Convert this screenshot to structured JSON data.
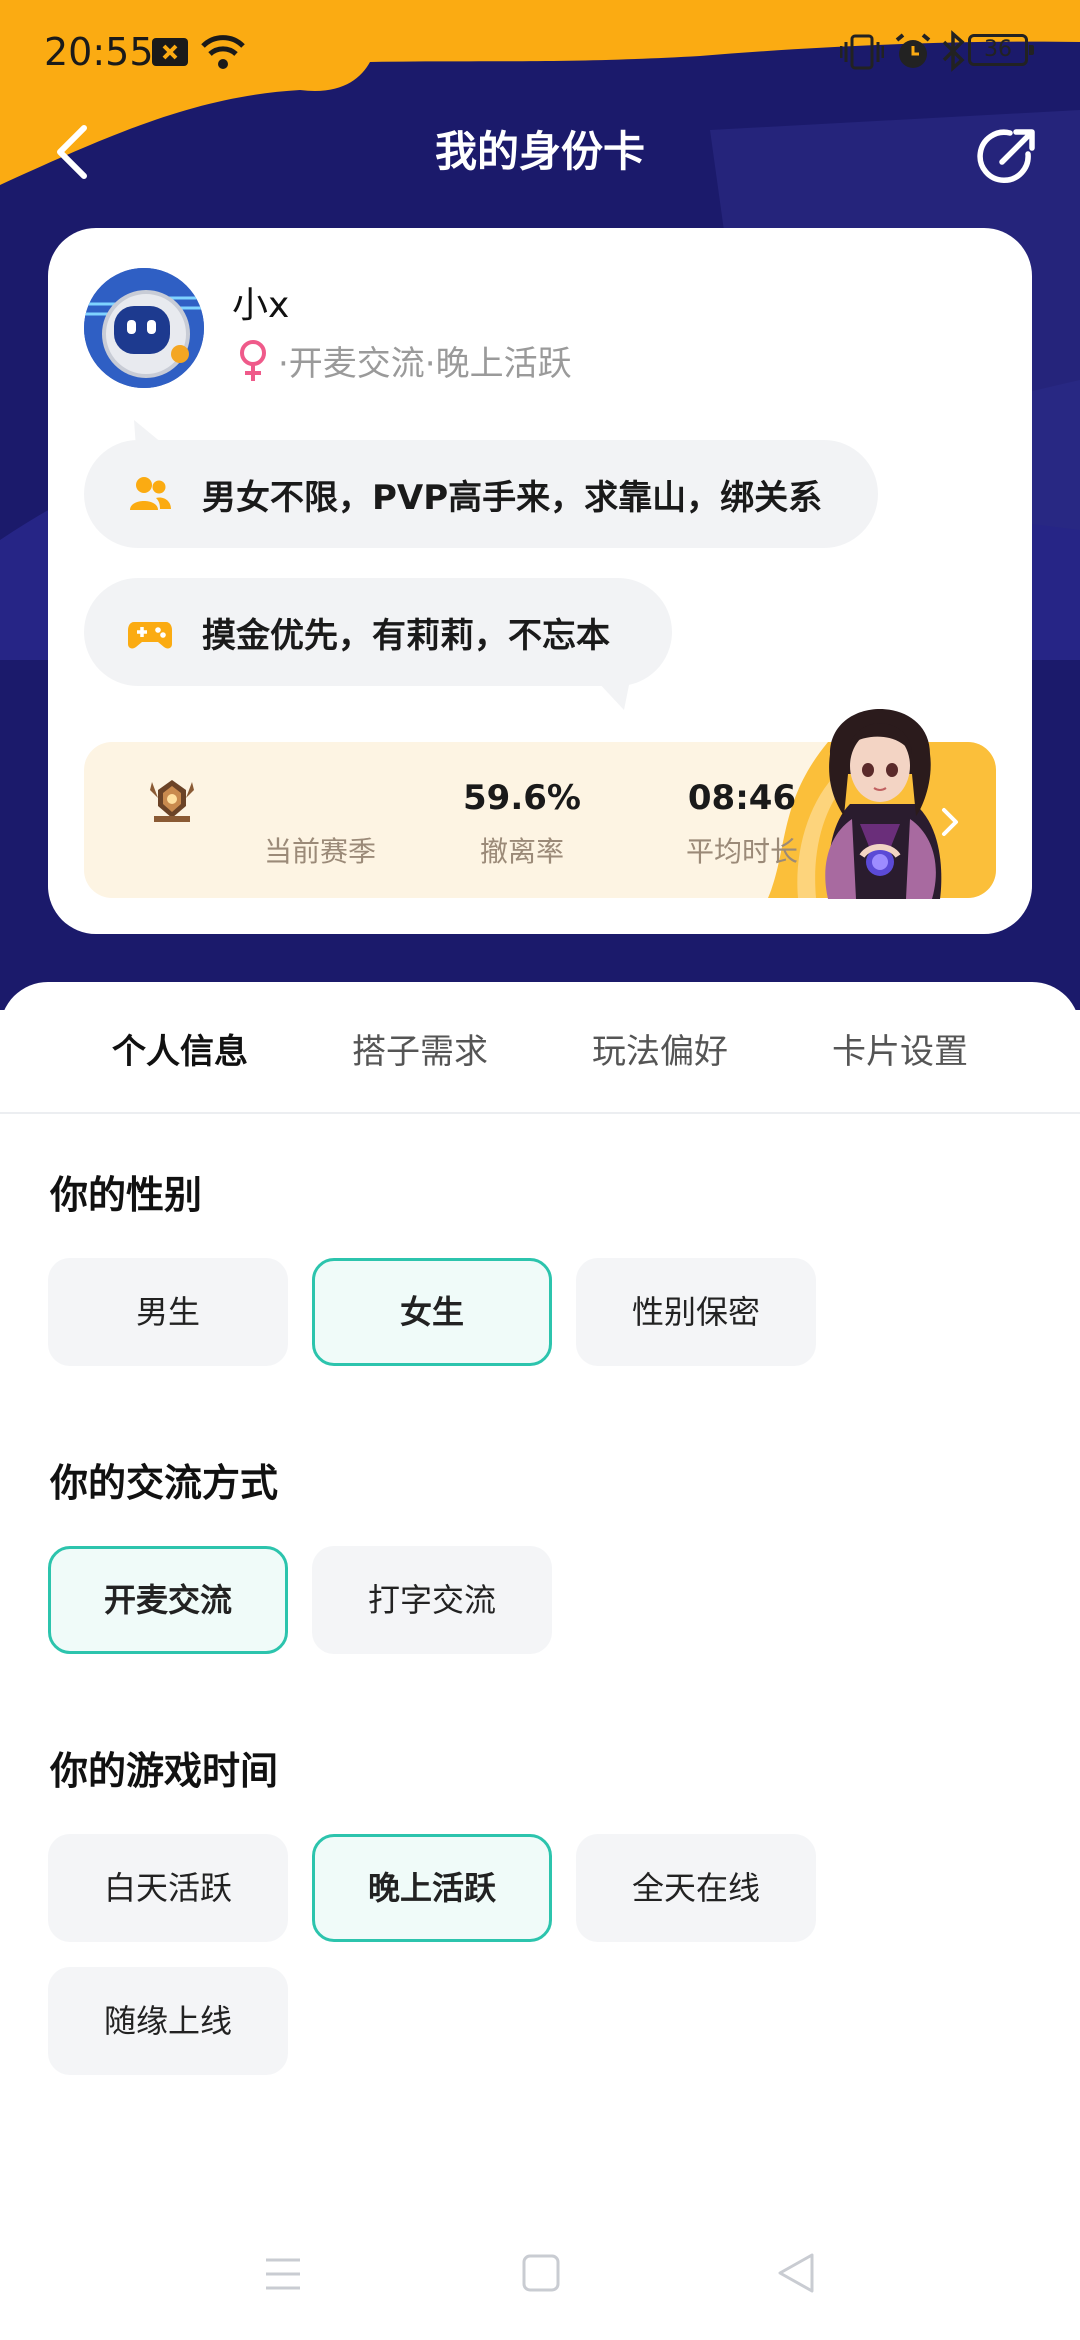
{
  "status_bar": {
    "time": "20:55",
    "battery": "36"
  },
  "header": {
    "title": "我的身份卡"
  },
  "profile": {
    "name": "小x",
    "tags": "·开麦交流·晚上活跃",
    "bubble1": "男女不限，PVP高手来，求靠山，绑关系",
    "bubble2": "摸金优先，有莉莉，不忘本"
  },
  "stats": {
    "season_label": "当前赛季",
    "escape_value": "59.6%",
    "escape_label": "撤离率",
    "duration_value": "08:46",
    "duration_label": "平均时长"
  },
  "tabs": [
    "个人信息",
    "搭子需求",
    "玩法偏好",
    "卡片设置"
  ],
  "sections": {
    "gender": {
      "title": "你的性别",
      "options": [
        "男生",
        "女生",
        "性别保密"
      ],
      "selected": "女生"
    },
    "comm": {
      "title": "你的交流方式",
      "options": [
        "开麦交流",
        "打字交流"
      ],
      "selected": "开麦交流"
    },
    "time": {
      "title": "你的游戏时间",
      "options": [
        "白天活跃",
        "晚上活跃",
        "全天在线",
        "随缘上线"
      ],
      "selected": "晚上活跃"
    }
  },
  "colors": {
    "header_navy": "#1b1a6b",
    "header_orange": "#fbab12",
    "accent_teal": "#2cc4ad",
    "stats_gold": "#fbbf3a"
  }
}
